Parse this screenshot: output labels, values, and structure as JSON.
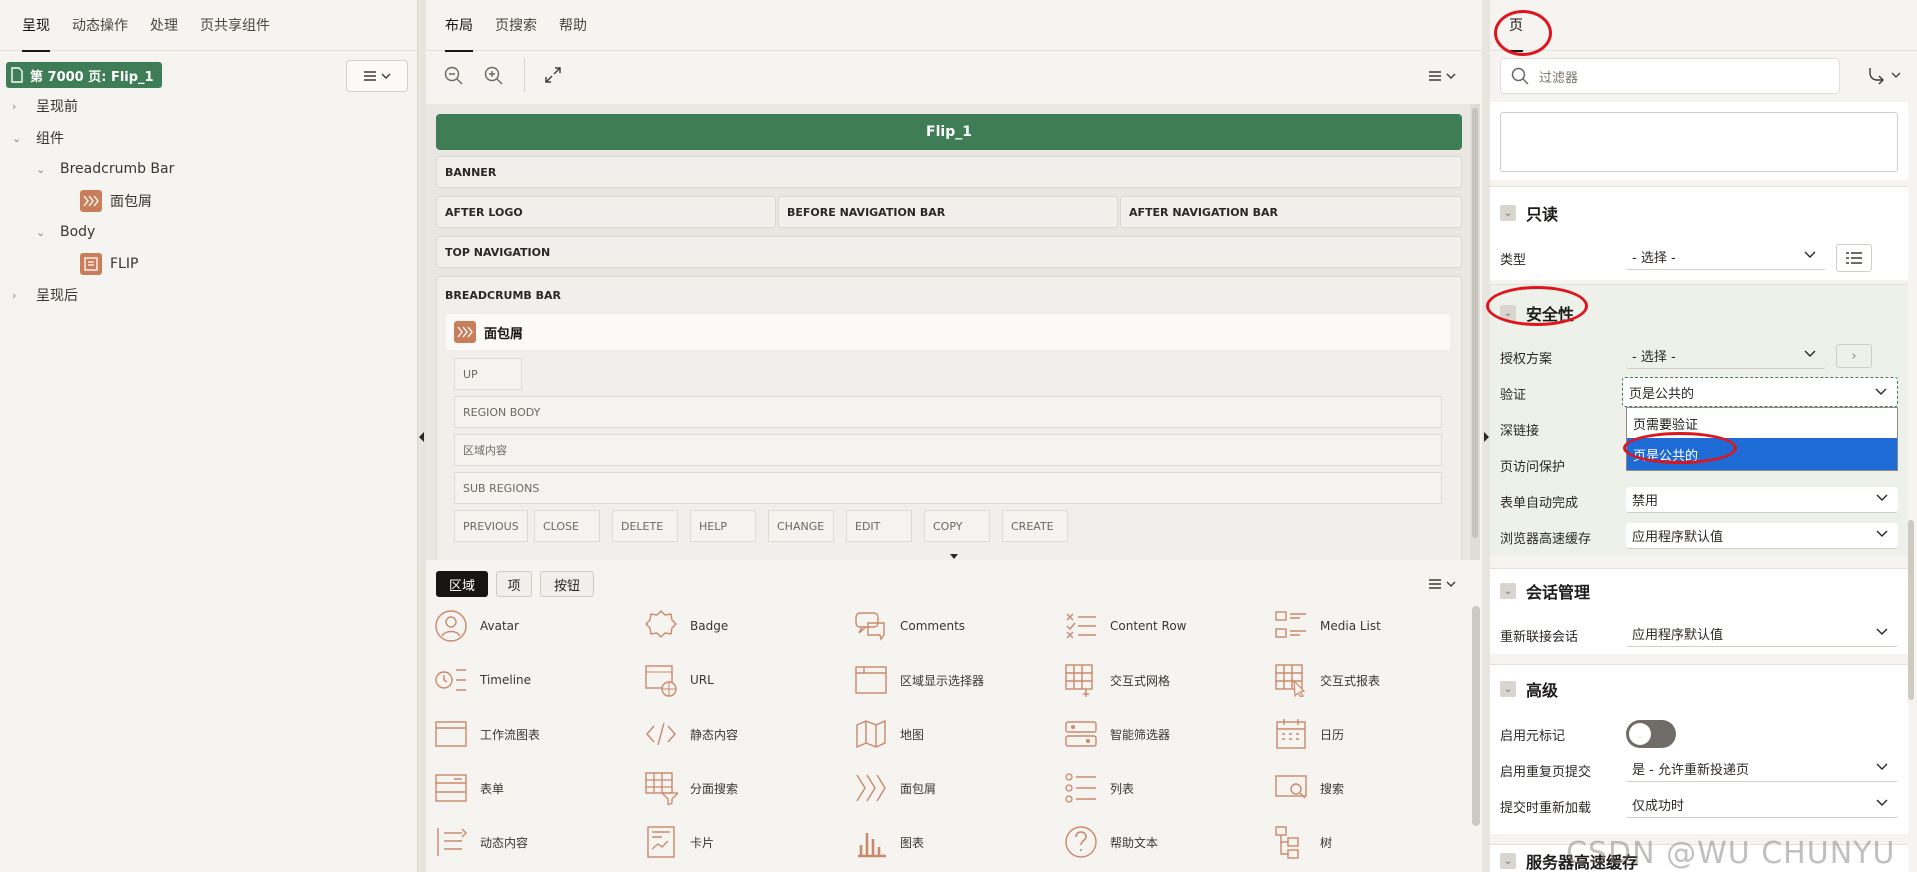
{
  "left": {
    "tabs": [
      "呈现",
      "动态操作",
      "处理",
      "页共享组件"
    ],
    "page_badge": "第 7000 页: Flip_1",
    "tree": {
      "before": "呈现前",
      "components": "组件",
      "breadcrumb_bar": "Breadcrumb Bar",
      "breadcrumb": "面包屑",
      "body": "Body",
      "flip": "FLIP",
      "after": "呈现后"
    }
  },
  "center": {
    "tabs": [
      "布局",
      "页搜索",
      "帮助"
    ],
    "page_title": "Flip_1",
    "regions": {
      "banner": "BANNER",
      "after_logo": "AFTER LOGO",
      "before_nav": "BEFORE NAVIGATION BAR",
      "after_nav": "AFTER NAVIGATION BAR",
      "top_nav": "TOP NAVIGATION",
      "breadcrumb_bar": "BREADCRUMB BAR"
    },
    "breadcrumb_region": {
      "title": "面包屑",
      "up": "UP",
      "region_body": "REGION BODY",
      "region_content": "区域内容",
      "sub_regions": "SUB REGIONS",
      "buttons": [
        "PREVIOUS",
        "CLOSE",
        "DELETE",
        "HELP",
        "CHANGE",
        "EDIT",
        "COPY",
        "CREATE"
      ]
    },
    "gallery_tabs": [
      "区域",
      "项",
      "按钮"
    ],
    "gallery": [
      [
        "Avatar",
        "Badge",
        "Comments",
        "Content Row",
        "Media List"
      ],
      [
        "Timeline",
        "URL",
        "区域显示选择器",
        "交互式网格",
        "交互式报表"
      ],
      [
        "工作流图表",
        "静态内容",
        "地图",
        "智能筛选器",
        "日历"
      ],
      [
        "表单",
        "分面搜索",
        "面包屑",
        "列表",
        "搜索"
      ],
      [
        "动态内容",
        "卡片",
        "图表",
        "帮助文本",
        "树"
      ]
    ]
  },
  "right": {
    "tab": "页",
    "filter_placeholder": "过滤器",
    "readonly": {
      "title": "只读",
      "type_label": "类型",
      "type_value": "- 选择 -"
    },
    "security": {
      "title": "安全性",
      "auth_scheme_label": "授权方案",
      "auth_scheme_value": "- 选择 -",
      "auth_label": "验证",
      "auth_value": "页是公共的",
      "options": [
        "页需要验证",
        "页是公共的"
      ],
      "deep_link_label": "深链接",
      "page_access_label": "页访问保护",
      "autocomplete_label": "表单自动完成",
      "autocomplete_value": "禁用",
      "cache_label": "浏览器高速缓存",
      "cache_value": "应用程序默认值"
    },
    "session": {
      "title": "会话管理",
      "rejoin_label": "重新联接会话",
      "rejoin_value": "应用程序默认值"
    },
    "advanced": {
      "title": "高级",
      "meta_label": "启用元标记",
      "resubmit_label": "启用重复页提交",
      "resubmit_value": "是 - 允许重新投递页",
      "reload_label": "提交时重新加载",
      "reload_value": "仅成功时"
    },
    "server_cache": {
      "title": "服务器高速缓存"
    }
  },
  "watermark": "CSDN @WU CHUNYU"
}
